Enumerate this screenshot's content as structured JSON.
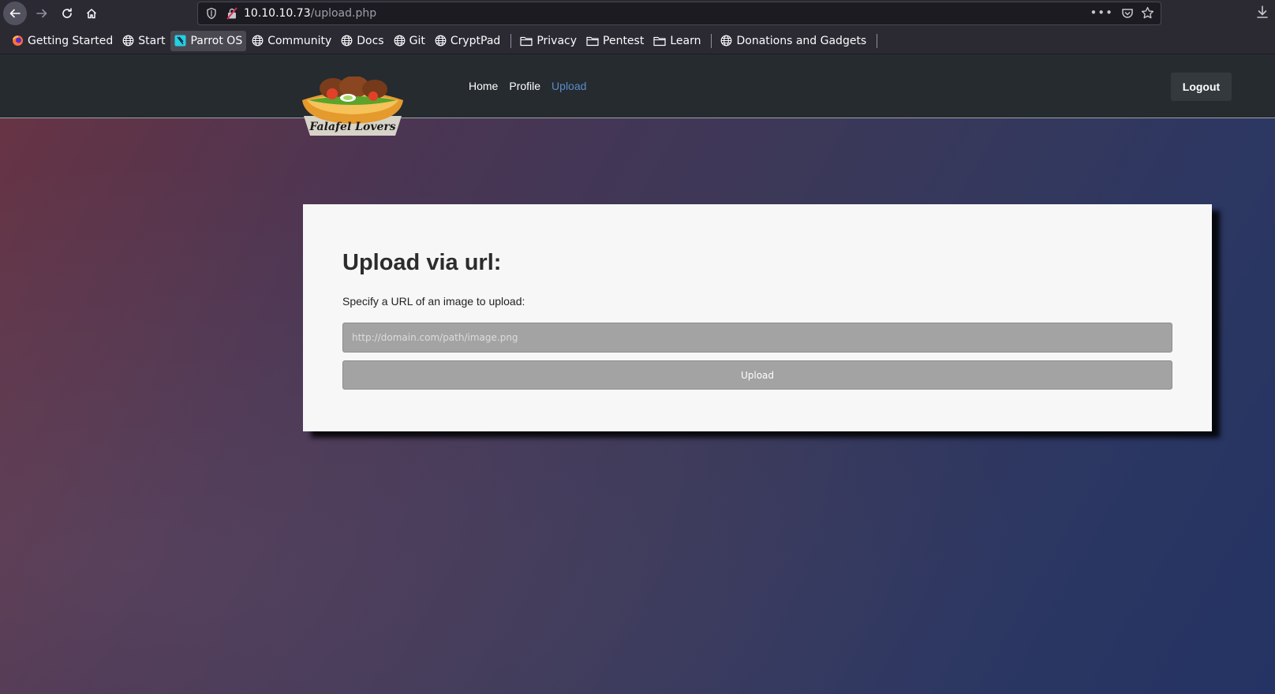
{
  "browser": {
    "url_host": "10.10.10.73",
    "url_path": "/upload.php",
    "bookmarks": [
      {
        "label": "Getting Started",
        "icon": "firefox-icon"
      },
      {
        "label": "Start",
        "icon": "globe-icon"
      },
      {
        "label": "Parrot OS",
        "icon": "parrot-icon"
      },
      {
        "label": "Community",
        "icon": "globe-icon"
      },
      {
        "label": "Docs",
        "icon": "globe-icon"
      },
      {
        "label": "Git",
        "icon": "globe-icon"
      },
      {
        "label": "CryptPad",
        "icon": "globe-icon"
      },
      {
        "label": "Privacy",
        "icon": "folder-icon"
      },
      {
        "label": "Pentest",
        "icon": "folder-icon"
      },
      {
        "label": "Learn",
        "icon": "folder-icon"
      },
      {
        "label": "Donations and Gadgets",
        "icon": "globe-icon"
      }
    ]
  },
  "site": {
    "logo_text": "Falafel Lovers",
    "nav": {
      "home": "Home",
      "profile": "Profile",
      "upload": "Upload"
    },
    "logout_label": "Logout"
  },
  "upload_form": {
    "title": "Upload via url:",
    "label": "Specify a URL of an image to upload:",
    "input_placeholder": "http://domain.com/path/image.png",
    "input_value": "",
    "button_label": "Upload"
  },
  "colors": {
    "accent_link": "#5b8cc8",
    "navbar_bg": "#262b2f",
    "card_bg": "#f7f7f7"
  }
}
